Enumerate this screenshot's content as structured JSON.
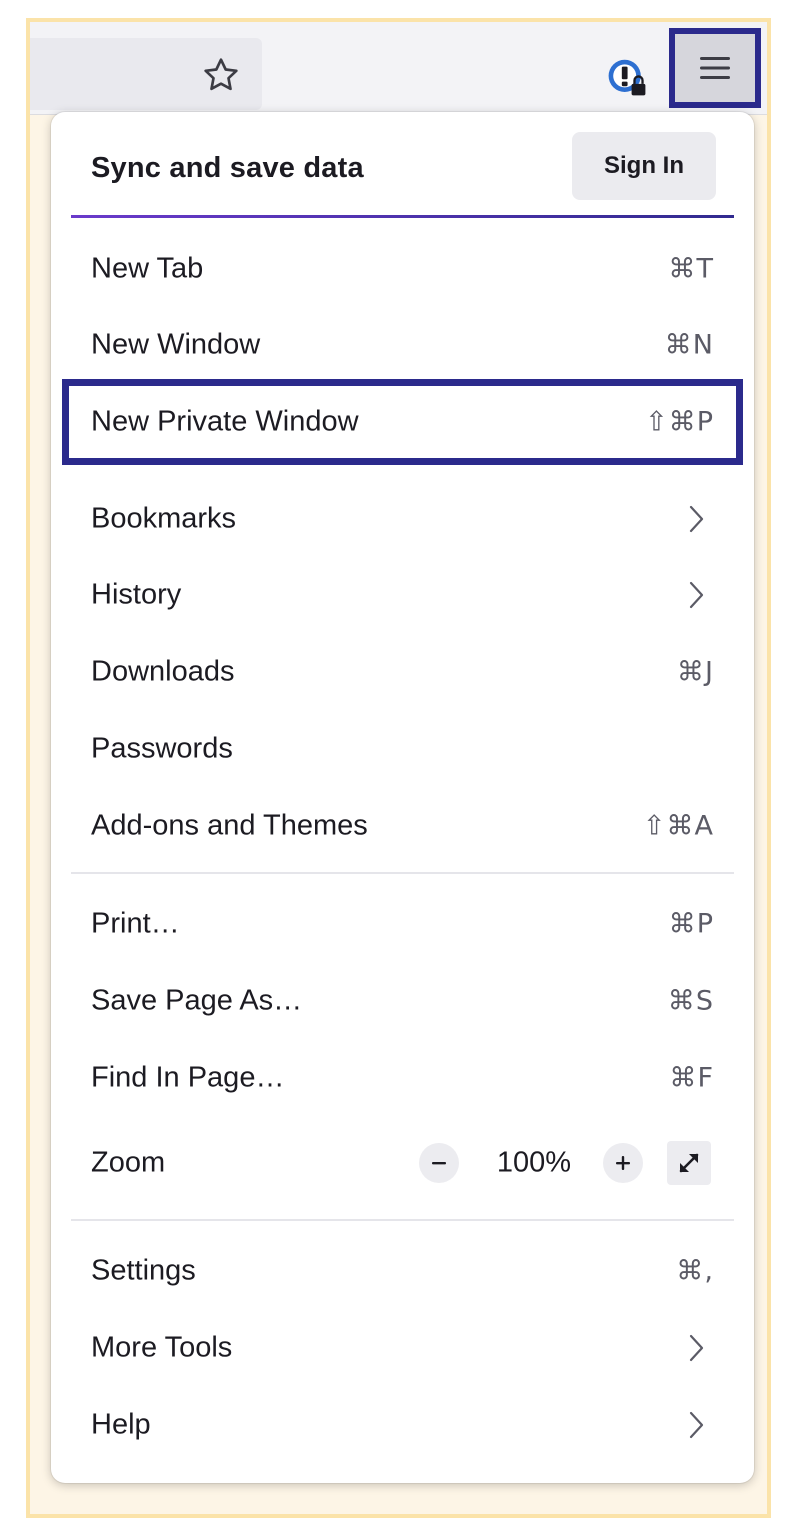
{
  "toolbar": {
    "star_icon": "star-icon",
    "extension_icon": "extension-icon",
    "menu_icon": "hamburger-menu-icon"
  },
  "sync": {
    "title": "Sync and save data",
    "sign_in_label": "Sign In"
  },
  "menu": {
    "items": [
      {
        "label": "New Tab",
        "shortcut": "⌘T"
      },
      {
        "label": "New Window",
        "shortcut": "⌘N"
      },
      {
        "label": "New Private Window",
        "shortcut": "⇧⌘P"
      },
      {
        "label": "Bookmarks",
        "submenu": true
      },
      {
        "label": "History",
        "submenu": true
      },
      {
        "label": "Downloads",
        "shortcut": "⌘J"
      },
      {
        "label": "Passwords",
        "shortcut": ""
      },
      {
        "label": "Add-ons and Themes",
        "shortcut": "⇧⌘A"
      },
      {
        "label": "Print…",
        "shortcut": "⌘P"
      },
      {
        "label": "Save Page As…",
        "shortcut": "⌘S"
      },
      {
        "label": "Find In Page…",
        "shortcut": "⌘F"
      },
      {
        "label": "Settings",
        "shortcut": "⌘,"
      },
      {
        "label": "More Tools",
        "submenu": true
      },
      {
        "label": "Help",
        "submenu": true
      }
    ],
    "zoom": {
      "label": "Zoom",
      "value": "100%",
      "minus": "−",
      "plus": "+"
    }
  },
  "colors": {
    "highlight_border": "#2b2a8c",
    "frame_border": "#fbe3a9",
    "sync_divider": "#6a3acb"
  }
}
